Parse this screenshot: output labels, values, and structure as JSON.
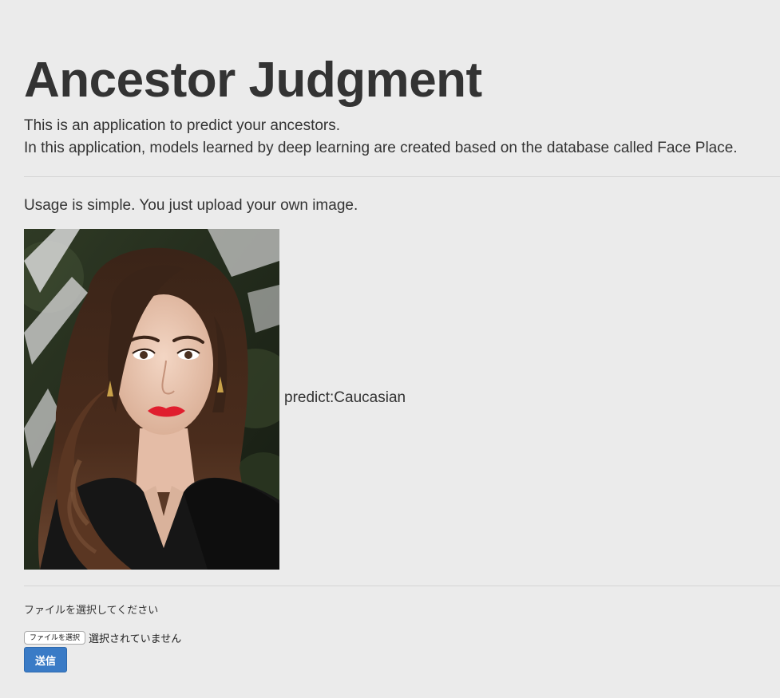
{
  "header": {
    "title": "Ancestor Judgment",
    "description_lines": [
      "This is an application to predict your ancestors.",
      "In this application, models learned by deep learning are created based on the database called Face Place."
    ]
  },
  "main": {
    "usage_text": "Usage is simple. You just upload your own image.",
    "prediction_text": "predict:Caucasian"
  },
  "upload_form": {
    "label": "ファイルを選択してください",
    "file_button_label": "ファイルを選択",
    "file_status": "選択されていません",
    "submit_label": "送信",
    "submit_color": "#3a7bc6"
  },
  "colors": {
    "background": "#ebebeb",
    "text": "#333333",
    "divider": "#d4d4d4"
  }
}
